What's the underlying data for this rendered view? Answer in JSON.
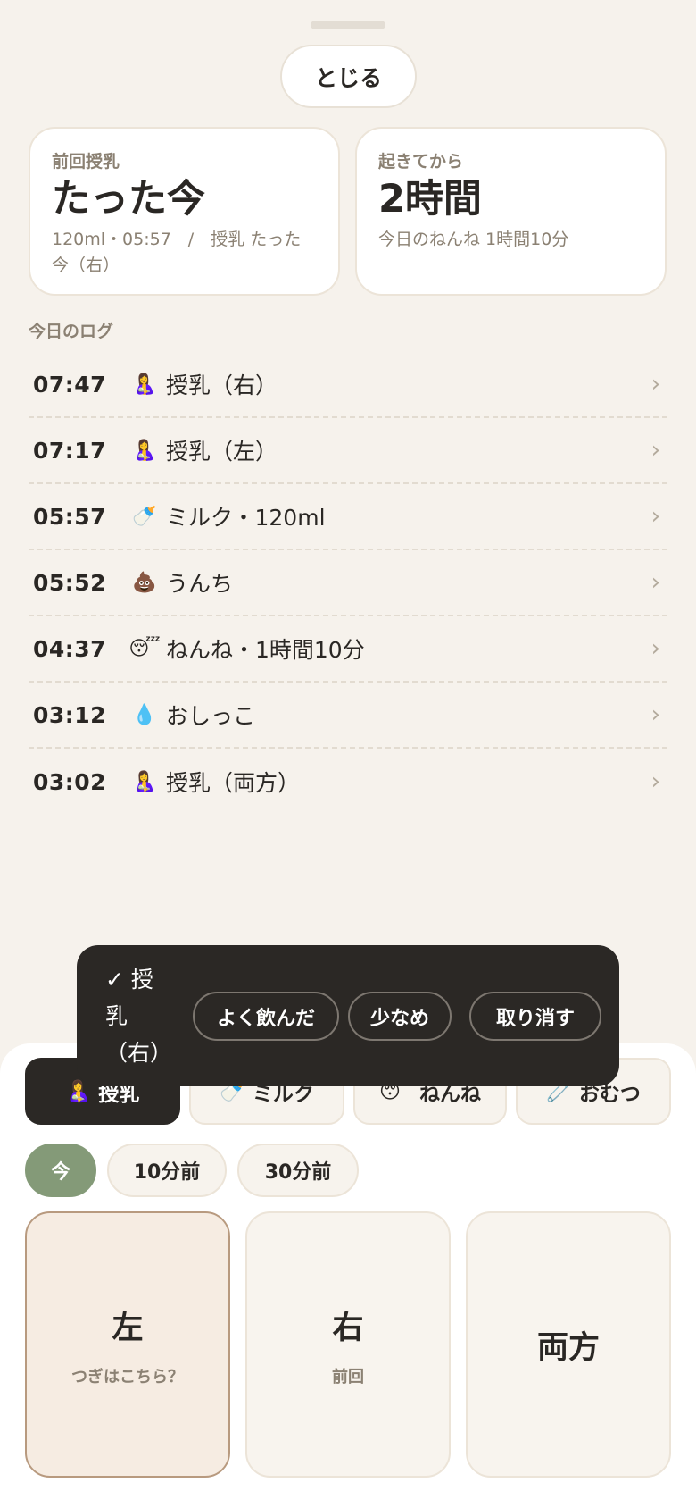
{
  "header": {
    "close_label": "とじる"
  },
  "last_feed": {
    "label": "前回授乳",
    "value": "たった今",
    "sub": "120ml・05:57　/　授乳 たった今（右）"
  },
  "awake": {
    "label": "起きてから",
    "value": "2時間",
    "sub": "今日のねんね 1時間10分"
  },
  "log_section_title": "今日のログ",
  "logs": [
    {
      "time": "07:47",
      "icon": "🤱",
      "label": "授乳（右）"
    },
    {
      "time": "07:17",
      "icon": "🤱",
      "label": "授乳（左）"
    },
    {
      "time": "05:57",
      "icon": "🍼",
      "label": "ミルク・120ml"
    },
    {
      "time": "05:52",
      "icon": "💩",
      "label": "うんち"
    },
    {
      "time": "04:37",
      "icon": "😴",
      "label": "ねんね・1時間10分"
    },
    {
      "time": "03:12",
      "icon": "💧",
      "label": "おしっこ"
    },
    {
      "time": "03:02",
      "icon": "🤱",
      "label": "授乳（両方）"
    }
  ],
  "chevron": "›",
  "tabs": [
    {
      "icon": "🤱",
      "label": "授乳"
    },
    {
      "icon": "🍼",
      "label": "ミルク"
    },
    {
      "icon": "😴",
      "label": "ねんね"
    },
    {
      "icon": "🧷",
      "label": "おむつ"
    }
  ],
  "time_chips": [
    "今",
    "10分前",
    "30分前"
  ],
  "sides": [
    {
      "label": "左",
      "sub": "つぎはこちら？"
    },
    {
      "label": "右",
      "sub": "前回"
    },
    {
      "label": "両方",
      "sub": ""
    }
  ],
  "toast": {
    "check": "✓ 授乳（右）",
    "buttons": [
      "よく飲んだ",
      "少なめ",
      "取り消す"
    ]
  },
  "colors": {
    "background": "#f6f2ec",
    "dark": "#2b2825",
    "accent_green": "#849a78",
    "suggested_border": "#b89a7f"
  }
}
